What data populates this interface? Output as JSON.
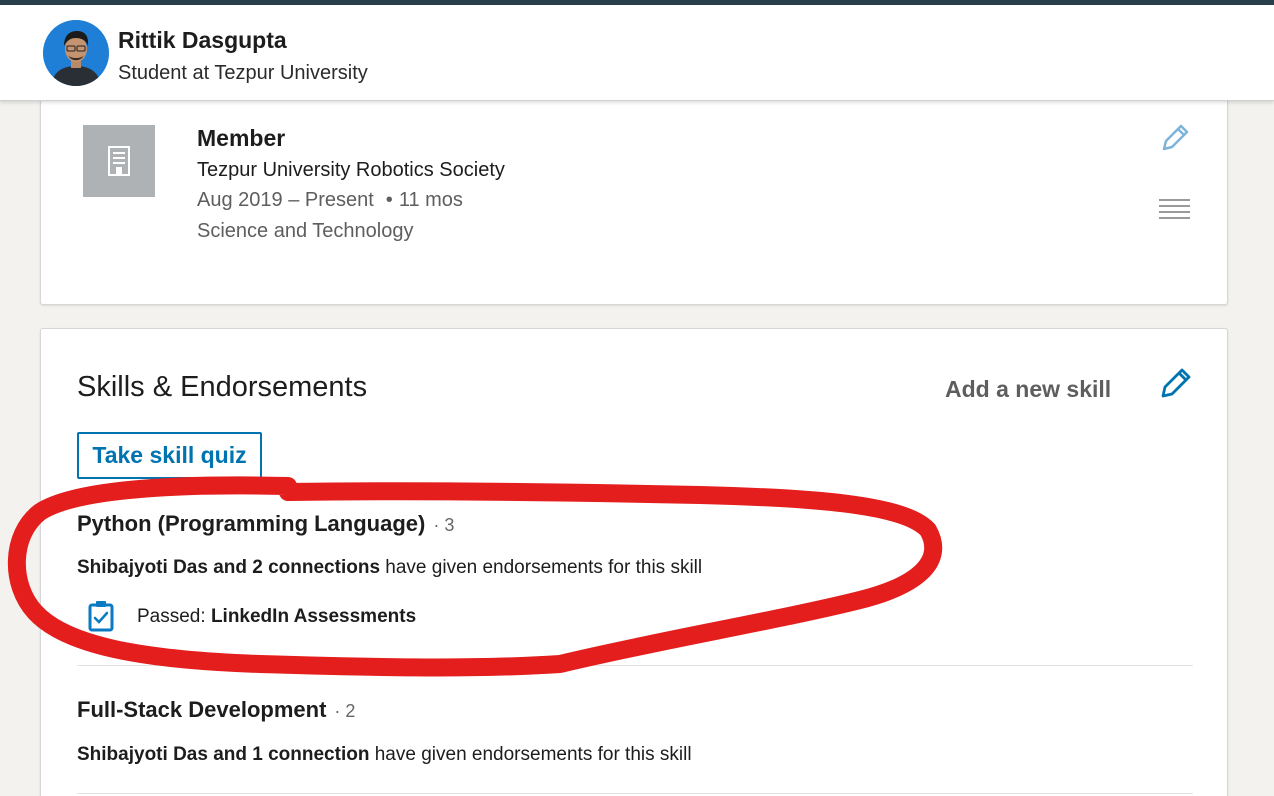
{
  "header": {
    "name": "Rittik Dasgupta",
    "headline": "Student at Tezpur University"
  },
  "experience": {
    "title": "Member",
    "organization": "Tezpur University Robotics Society",
    "dates": "Aug 2019 – Present",
    "duration": "11 mos",
    "category": "Science and Technology"
  },
  "skills": {
    "section_title": "Skills & Endorsements",
    "add_label": "Add a new skill",
    "quiz_label": "Take skill quiz",
    "items": [
      {
        "name": "Python (Programming Language)",
        "count": "· 3",
        "endorsers_bold": "Shibajyoti Das and 2 connections",
        "endorsers_rest": "have given endorsements for this skill",
        "assessment_prefix": "Passed:",
        "assessment_name": "LinkedIn Assessments"
      },
      {
        "name": "Full-Stack Development",
        "count": "· 2",
        "endorsers_bold": "Shibajyoti Das and 1 connection",
        "endorsers_rest": "have given endorsements for this skill"
      }
    ]
  },
  "colors": {
    "accent": "#0073b1",
    "annotation": "#e41d1d"
  },
  "icons": [
    "avatar",
    "building-icon",
    "pencil-icon",
    "reorder-icon",
    "pencil-icon",
    "clipboard-check-icon"
  ]
}
